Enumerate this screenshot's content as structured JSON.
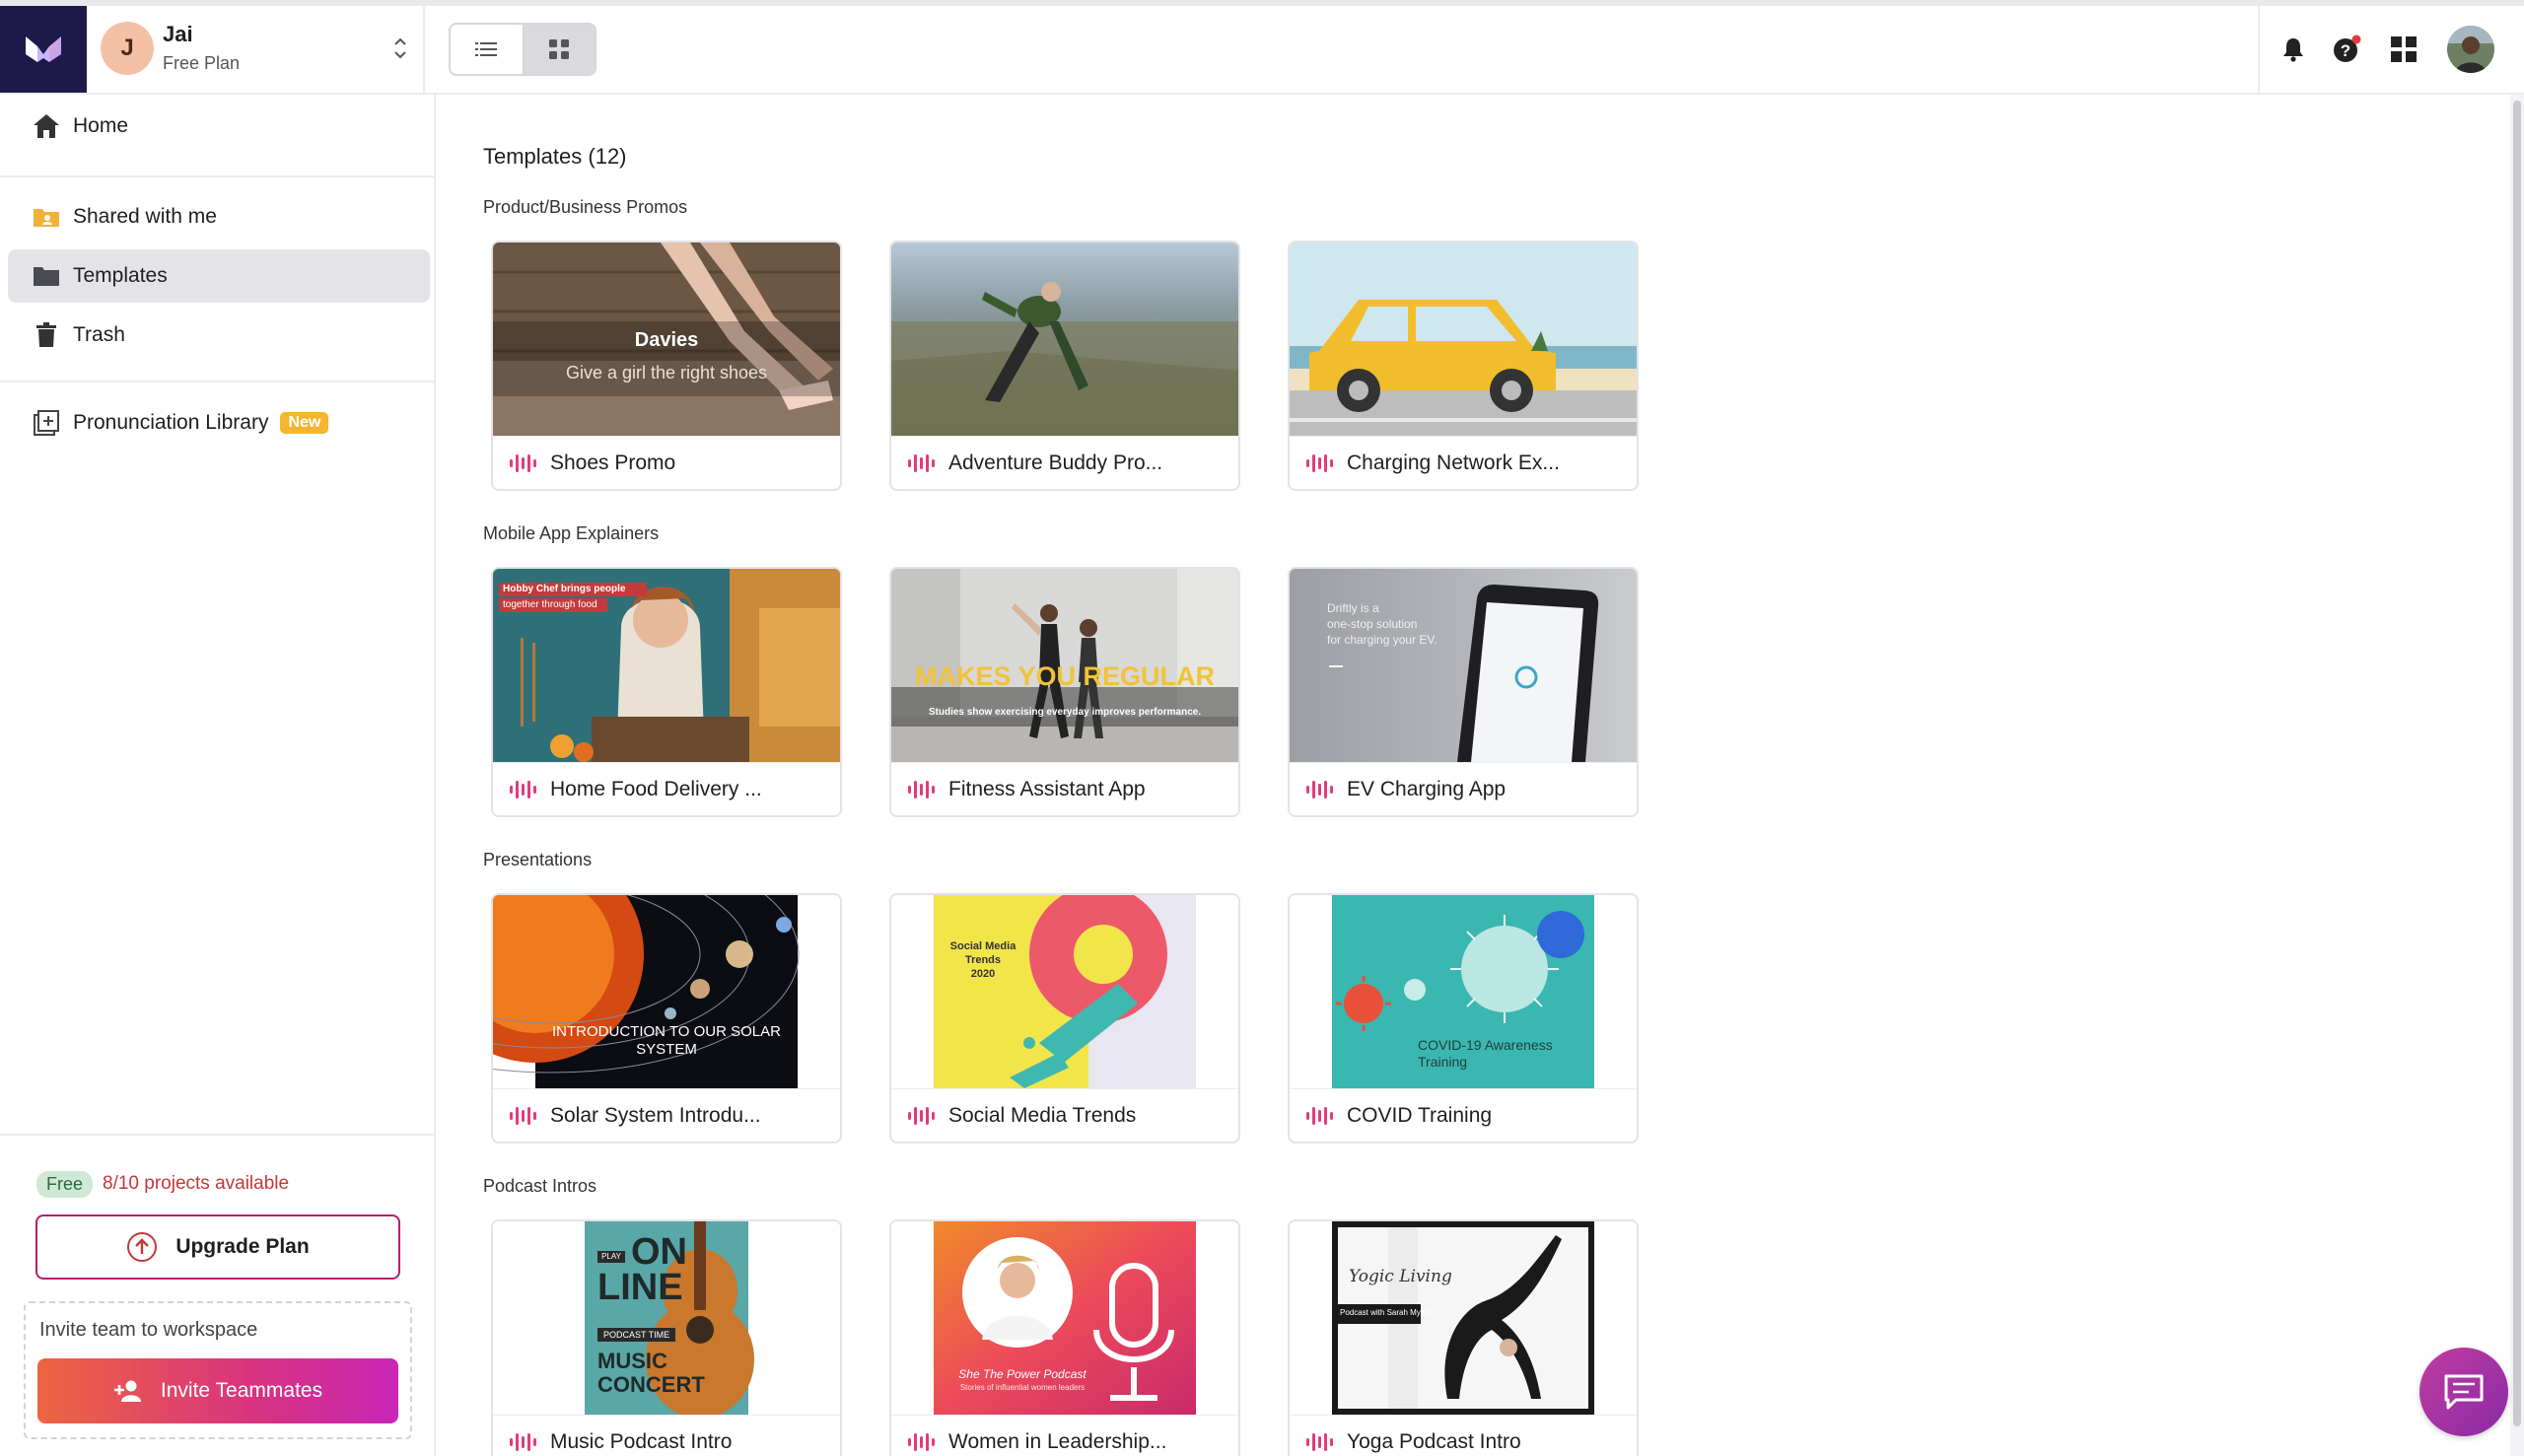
{
  "account": {
    "initial": "J",
    "name": "Jai",
    "plan": "Free Plan"
  },
  "header": {
    "view_modes": [
      "list-view",
      "grid-view"
    ],
    "active_view": "grid-view",
    "icons": [
      "bell-icon",
      "help-icon",
      "apps-grid-icon",
      "profile-avatar"
    ],
    "accent": "#e23b7e"
  },
  "sidebar": {
    "items": [
      {
        "label": "Home",
        "icon": "home-icon"
      },
      {
        "label": "Shared with me",
        "icon": "shared-folder-icon"
      },
      {
        "label": "Templates",
        "icon": "folder-icon",
        "active": true
      },
      {
        "label": "Trash",
        "icon": "trash-icon"
      },
      {
        "label": "Pronunciation Library",
        "icon": "library-add-icon",
        "badge": "New"
      }
    ],
    "plan_badge": "Free",
    "projects_available": "8/10 projects available",
    "upgrade_label": "Upgrade Plan",
    "invite_label": "Invite team to workspace",
    "invite_button": "Invite Teammates"
  },
  "main": {
    "title": "Templates (12)",
    "sections": [
      {
        "title": "Product/Business Promos",
        "cards": [
          {
            "name": "Shoes Promo",
            "thumb_line1": "Davies",
            "thumb_line2": "Give a girl the right shoes"
          },
          {
            "name": "Adventure Buddy Pro..."
          },
          {
            "name": "Charging Network Ex..."
          }
        ]
      },
      {
        "title": "Mobile App Explainers",
        "cards": [
          {
            "name": "Home Food Delivery ...",
            "thumb_line1": "Hobby Chef brings people",
            "thumb_line2": "together through food"
          },
          {
            "name": "Fitness Assistant App",
            "thumb_line1": "MAKES YOU REGULAR",
            "thumb_line2": "Studies show exercising everyday improves performance."
          },
          {
            "name": "EV Charging App",
            "thumb_line1": "Driftly is a",
            "thumb_line2": "one-stop solution",
            "thumb_line3": "for charging your EV."
          }
        ]
      },
      {
        "title": "Presentations",
        "cards": [
          {
            "name": "Solar System Introdu...",
            "thumb_line1": "INTRODUCTION TO OUR SOLAR",
            "thumb_line2": "SYSTEM"
          },
          {
            "name": "Social Media Trends",
            "thumb_line1": "Social Media",
            "thumb_line2": "Trends",
            "thumb_line3": "2020"
          },
          {
            "name": "COVID Training",
            "thumb_line1": "COVID-19 Awareness",
            "thumb_line2": "Training"
          }
        ]
      },
      {
        "title": "Podcast Intros",
        "cards": [
          {
            "name": "Music Podcast Intro",
            "thumb_line1": "ON",
            "thumb_line2": "LINE",
            "thumb_line3": "PODCAST TIME",
            "thumb_line4": "MUSIC",
            "thumb_line5": "CONCERT",
            "thumb_tag": "PLAY"
          },
          {
            "name": "Women in Leadership...",
            "thumb_line1": "She The Power Podcast",
            "thumb_line2": "Stories of influential women leaders"
          },
          {
            "name": "Yoga Podcast Intro",
            "thumb_line1": "Yogic Living",
            "thumb_line2": "Podcast with Sarah Myles"
          }
        ]
      }
    ]
  }
}
